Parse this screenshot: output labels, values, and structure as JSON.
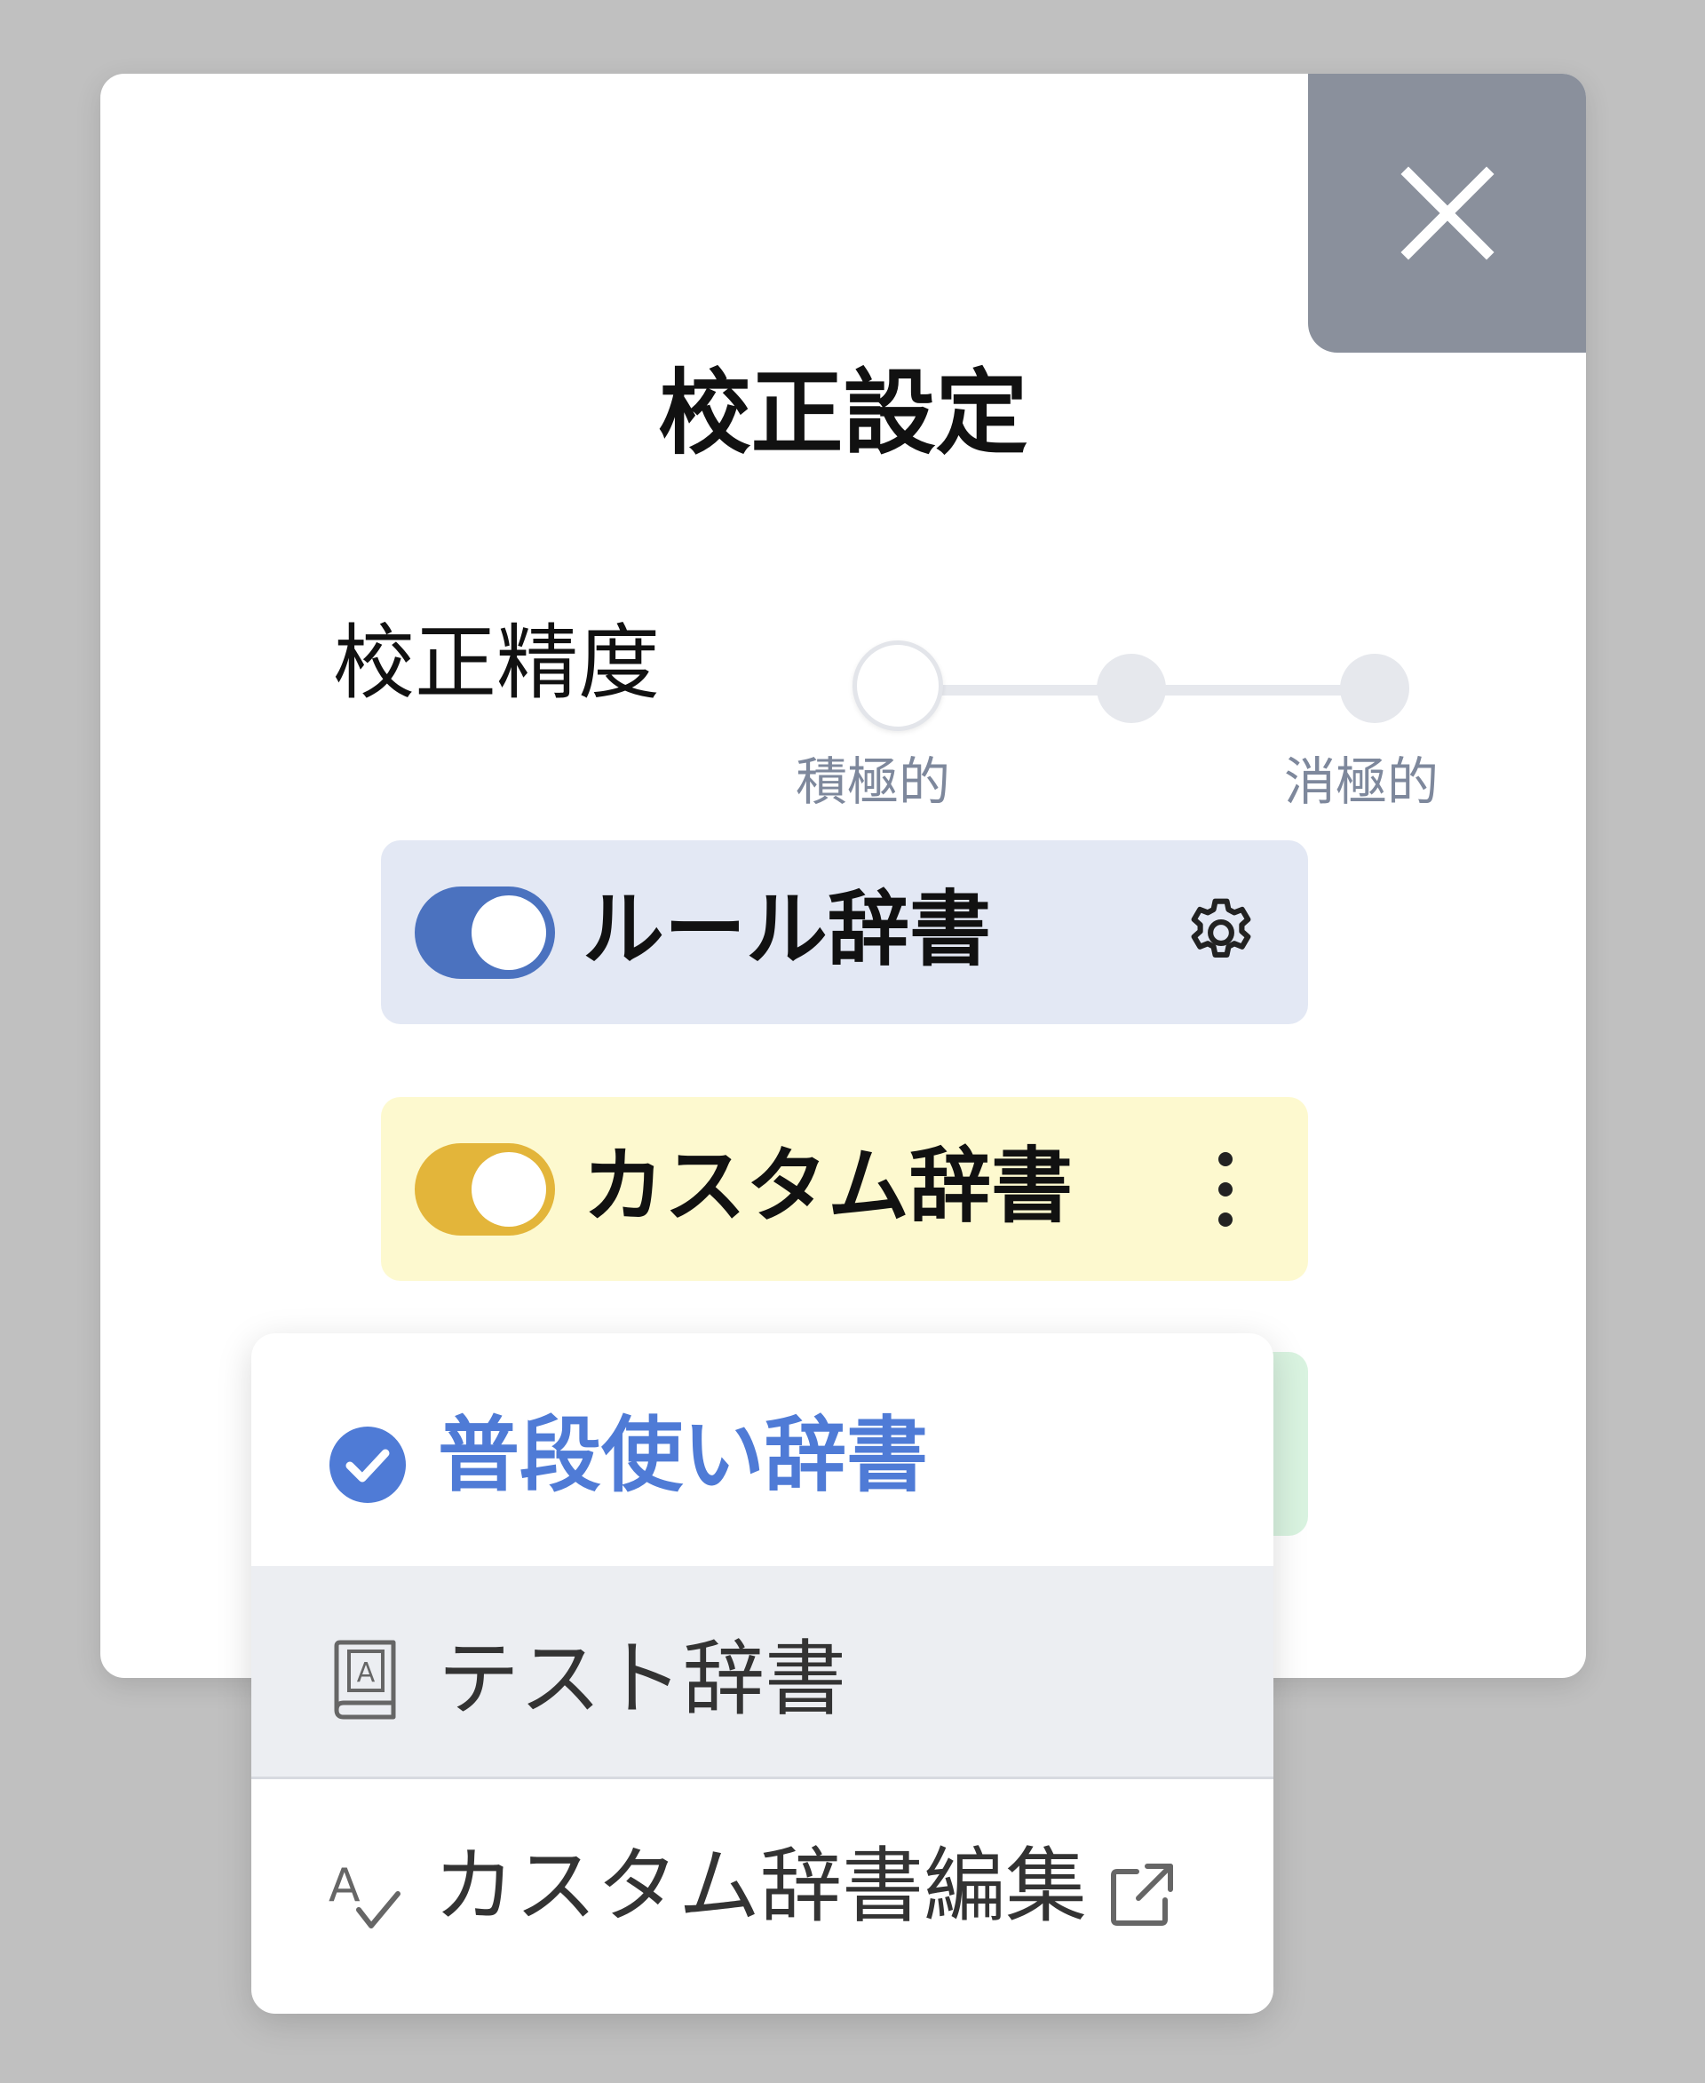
{
  "dialog": {
    "title": "校正設定",
    "close_icon": "close-icon"
  },
  "precision": {
    "label": "校正精度",
    "min_label": "積極的",
    "max_label": "消極的",
    "steps": 3,
    "selected_step": 1
  },
  "dictionaries": {
    "rule": {
      "label": "ルール辞書",
      "enabled": true,
      "color": "#4b72bf",
      "icon": "gear-icon"
    },
    "custom": {
      "label": "カスタム辞書",
      "enabled": true,
      "color": "#e3b53a",
      "icon": "kebab-menu-icon"
    }
  },
  "custom_menu": {
    "items": [
      {
        "label": "普段使い辞書",
        "icon": "check-circle-icon",
        "selected": true,
        "color": "#4f7bd6"
      },
      {
        "label": "テスト辞書",
        "icon": "dictionary-book-icon",
        "selected": false
      },
      {
        "label": "カスタム辞書編集",
        "icon": "spellcheck-icon",
        "trailing_icon": "external-link-icon"
      }
    ]
  }
}
